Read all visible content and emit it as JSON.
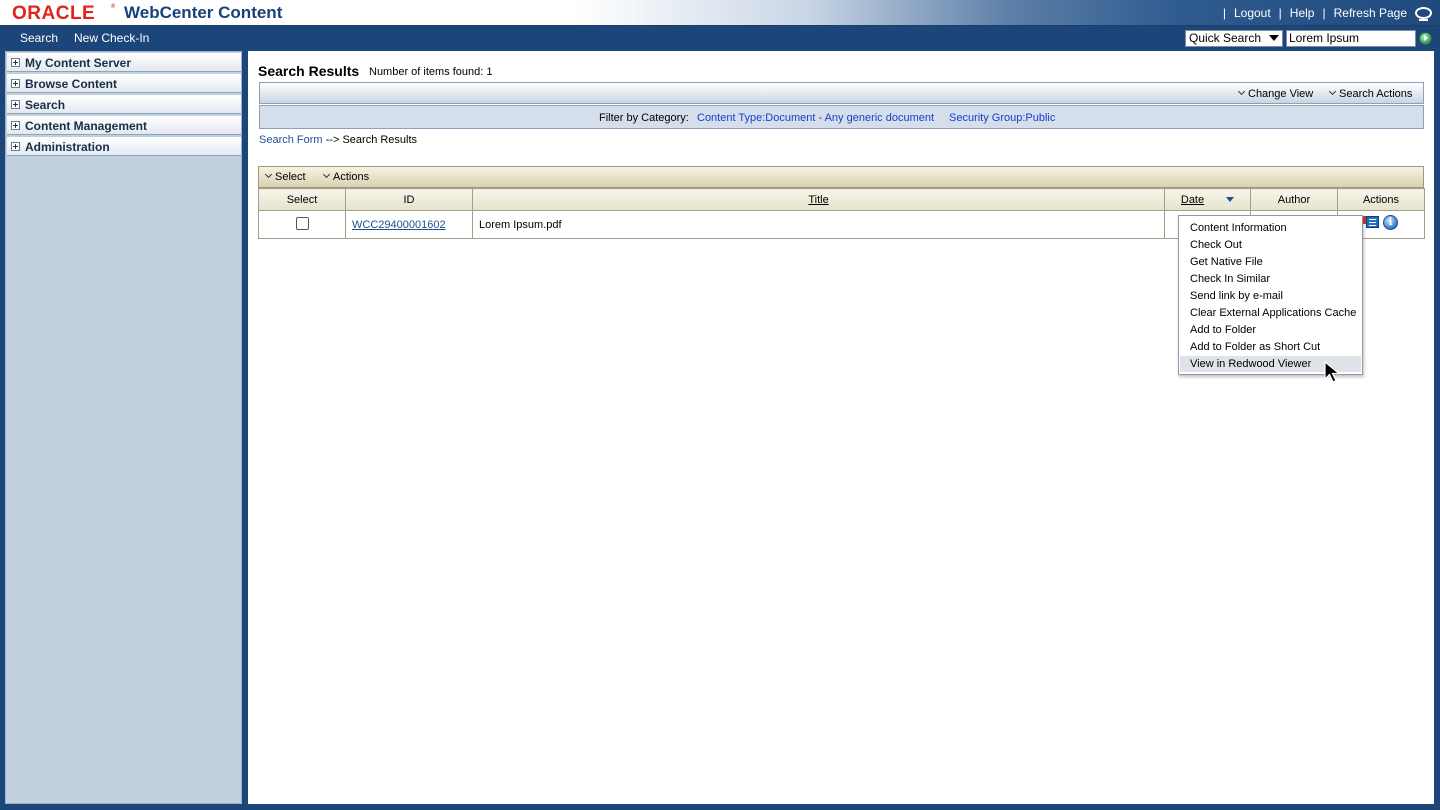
{
  "header": {
    "brand": "ORACLE",
    "product": "WebCenter Content",
    "links": [
      "Logout",
      "Help",
      "Refresh Page"
    ]
  },
  "nav": {
    "links": [
      "Search",
      "New Check-In"
    ],
    "quick_search_type": "Quick Search",
    "quick_search_value": "Lorem Ipsum"
  },
  "sidebar": {
    "items": [
      {
        "label": "My Content Server"
      },
      {
        "label": "Browse Content"
      },
      {
        "label": "Search"
      },
      {
        "label": "Content Management"
      },
      {
        "label": "Administration"
      }
    ]
  },
  "main": {
    "title": "Search Results",
    "items_found": "Number of items found: 1",
    "change_view": "Change View",
    "search_actions": "Search Actions",
    "filter_label": "Filter by Category:",
    "filter_content_type": "Content Type:Document - Any generic document",
    "filter_security_group": "Security Group:Public",
    "breadcrumb_link": "Search Form",
    "breadcrumb_sep": " --> ",
    "breadcrumb_current": "Search Results",
    "toolbar_select": "Select",
    "toolbar_actions": "Actions"
  },
  "table": {
    "columns": [
      "Select",
      "ID",
      "Title",
      "Date",
      "Author",
      "Actions"
    ],
    "rows": [
      {
        "id": "WCC29400001602",
        "title": "Lorem Ipsum.pdf",
        "date": "",
        "author": ""
      }
    ]
  },
  "popup_menu": {
    "items": [
      "Content Information",
      "Check Out",
      "Get Native File",
      "Check In Similar",
      "Send link by e-mail",
      "Clear External Applications Cache",
      "Add to Folder",
      "Add to Folder as Short Cut",
      "View in Redwood Viewer"
    ],
    "highlighted": "View in Redwood Viewer"
  },
  "colors": {
    "brand_red": "#e2231a",
    "nav_blue": "#1c4579",
    "sidebar_bg": "#c1d0de",
    "link_blue": "#1a3ec8"
  }
}
